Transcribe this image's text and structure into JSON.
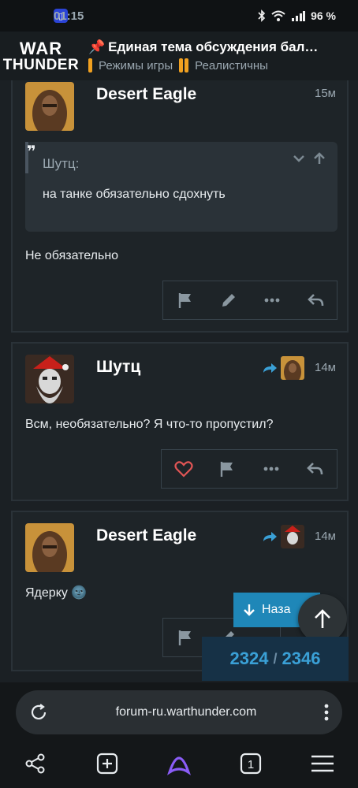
{
  "status_bar": {
    "time": "01:15",
    "battery": "96 %"
  },
  "header": {
    "logo_line1": "WAR",
    "logo_line2": "THUNDER",
    "title": "Единая тема обсуждения бал…",
    "crumb1": "Режимы игры",
    "crumb2": "Реалистичны"
  },
  "posts": [
    {
      "username": "Desert Eagle",
      "time": "15м",
      "quote_author": "Шутц:",
      "quote_text": "на танке обязательно сдохнуть",
      "text": "Не обязательно"
    },
    {
      "username": "Шутц",
      "time": "14м",
      "text": "Всм, необязательно? Я что-то пропустил?"
    },
    {
      "username": "Desert Eagle",
      "time": "14м",
      "text": "Ядерку",
      "emoji": "🌚"
    }
  ],
  "floating": {
    "back_label": "Наза",
    "counter_current": "2324",
    "counter_sep": "/",
    "counter_total": "2346"
  },
  "browser": {
    "url": "forum-ru.warthunder.com",
    "tabs_count": "1"
  },
  "colors": {
    "accent_blue": "#1f87b8",
    "crumb_orange": "#f0a020",
    "heart_red": "#e05555"
  }
}
